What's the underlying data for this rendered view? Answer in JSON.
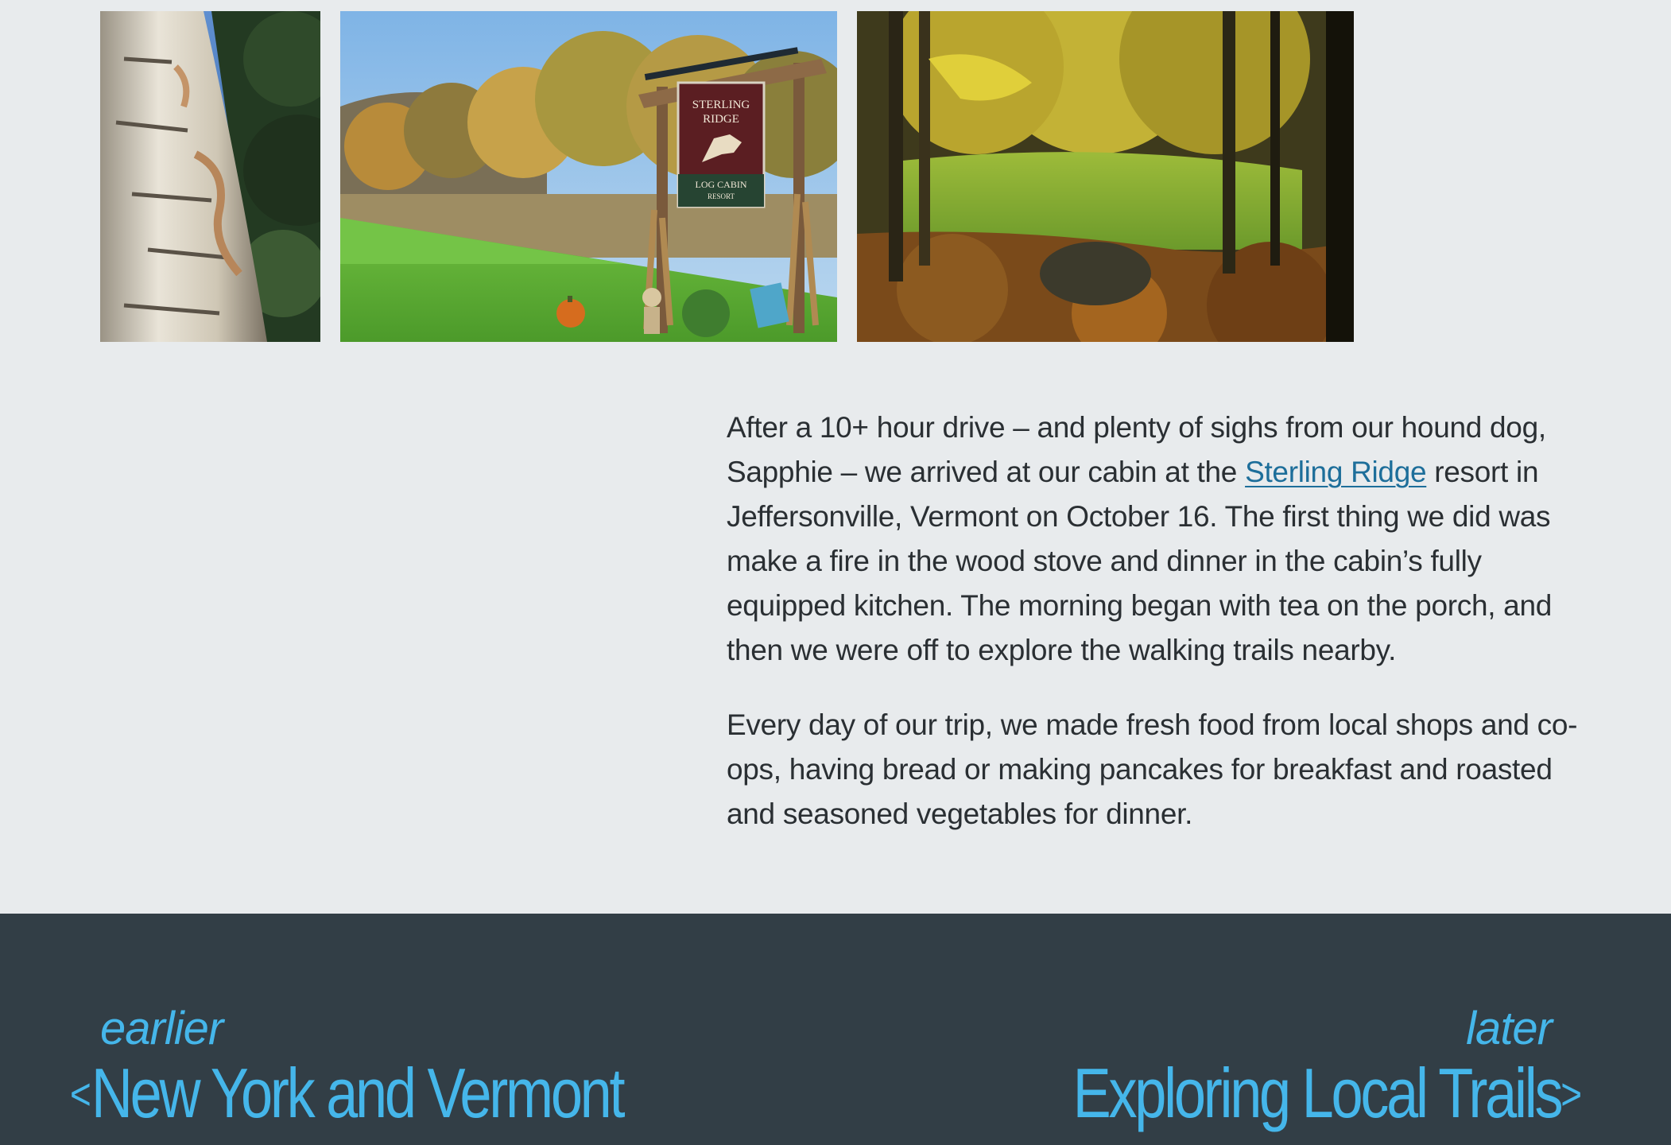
{
  "gallery": {
    "photos": [
      {
        "icon": "birch-bark-photo"
      },
      {
        "icon": "resort-sign-photo",
        "sign_line1": "STERLING",
        "sign_line2": "RIDGE",
        "sign_line3": "LOG CABIN",
        "sign_line4": "RESORT"
      },
      {
        "icon": "autumn-forest-photo"
      }
    ]
  },
  "article": {
    "p1_before_link": "After a 10+ hour drive – and plenty of sighs from our hound dog, Sapphie – we arrived at our cabin at the ",
    "p1_link": "Sterling Ridge",
    "p1_after_link": " resort in Jeffersonville, Vermont on October 16. The first thing we did was make a fire in the wood stove and dinner in the cabin’s fully equipped kitchen. The morning began with tea on the porch, and then we were off to explore the walking trails nearby.",
    "p2": "Every day of our trip, we made fresh food from local shops and co-ops, having bread or making pancakes for breakfast and roasted and seasoned vegetables for dinner."
  },
  "footer": {
    "prev": {
      "kicker": "earlier",
      "chevron": "<",
      "title": "New York and Vermont"
    },
    "next": {
      "kicker": "later",
      "chevron": ">",
      "title": "Exploring Local Trails"
    }
  },
  "colors": {
    "background": "#e8ebed",
    "footer_background": "#323e46",
    "nav_accent": "#45b6ea",
    "link": "#1d6e9a",
    "body_text": "#2a2f33"
  }
}
